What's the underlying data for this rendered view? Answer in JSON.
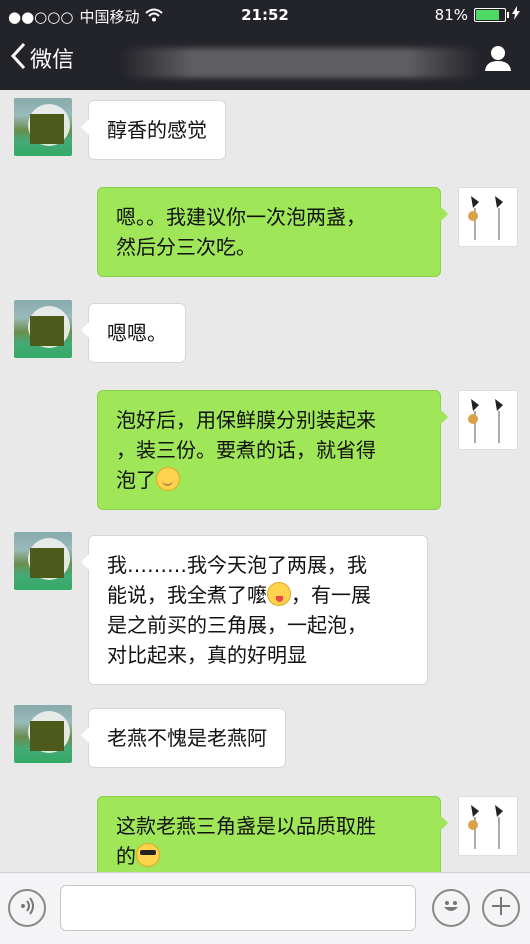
{
  "status_bar": {
    "signal": "●●○○○",
    "carrier": "中国移动",
    "time": "21:52",
    "battery_percent": "81%",
    "battery_level": 0.81
  },
  "nav": {
    "back_label": "微信"
  },
  "messages": [
    {
      "side": "in",
      "text": "醇香的感觉"
    },
    {
      "side": "out",
      "text_lines": [
        "嗯。。我建议你一次泡两盏，",
        "然后分三次吃。"
      ]
    },
    {
      "side": "in",
      "text": "嗯嗯。"
    },
    {
      "side": "out",
      "text_lines": [
        "泡好后，用保鲜膜分别装起来",
        "，装三份。要煮的话，就省得",
        "泡了"
      ],
      "emoji": "smile-emoji"
    },
    {
      "side": "in",
      "text_lines": [
        "我………我今天泡了两展，我",
        "能说，我全煮了嚒",
        "，有一展",
        "是之前买的三角展，一起泡，",
        "对比起来，真的好明显"
      ],
      "emoji": "tongue-emoji"
    },
    {
      "side": "in",
      "text": "老燕不愧是老燕阿"
    },
    {
      "side": "out",
      "text_lines": [
        "这款老燕三角盏是以品质取胜",
        "的"
      ],
      "emoji": "sunglasses-emoji"
    }
  ],
  "input": {
    "placeholder": ""
  },
  "colors": {
    "bar_dark": "#23242a",
    "outgoing_bubble": "#9fe658",
    "background": "#e9e9e9"
  }
}
